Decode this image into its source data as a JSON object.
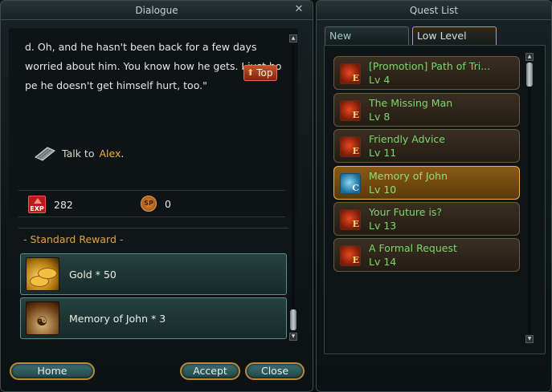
{
  "dialogue": {
    "title": "Dialogue",
    "lines": [
      "d. Oh, and he hasn't been back for a few days",
      "worried about him. You know how he gets. I just ho",
      "pe he doesn't get himself hurt, too.\""
    ],
    "hint_button_label": "Top",
    "talk_prefix": "Talk to",
    "talk_npc": "Alex",
    "talk_suffix": ".",
    "exp_icon_label": "EXP",
    "exp_value": "282",
    "sp_icon_label": "SP",
    "sp_value": "0",
    "reward_title": "- Standard Reward -",
    "rewards": [
      {
        "label": "Gold * 50",
        "icon": "gold-coins-icon"
      },
      {
        "label": "Memory of John * 3",
        "icon": "pouch-icon"
      }
    ],
    "buttons": {
      "home": "Home",
      "accept": "Accept",
      "close": "Close"
    }
  },
  "quest_list": {
    "title": "Quest List",
    "tabs": [
      {
        "label": "New",
        "active": false
      },
      {
        "label": "Low Level",
        "active": true
      }
    ],
    "quests": [
      {
        "name": "[Promotion] Path of Tri...",
        "level": "Lv 4",
        "icon": "epic-quest-icon",
        "selected": false
      },
      {
        "name": "The Missing Man",
        "level": "Lv 8",
        "icon": "epic-quest-icon",
        "selected": false
      },
      {
        "name": "Friendly Advice",
        "level": "Lv 11",
        "icon": "epic-quest-icon",
        "selected": false
      },
      {
        "name": "Memory of John",
        "level": "Lv 10",
        "icon": "continue-quest-icon",
        "selected": true
      },
      {
        "name": "Your Future is?",
        "level": "Lv 13",
        "icon": "epic-quest-icon",
        "selected": false
      },
      {
        "name": "A Formal Request",
        "level": "Lv 14",
        "icon": "epic-quest-icon",
        "selected": false
      }
    ]
  }
}
